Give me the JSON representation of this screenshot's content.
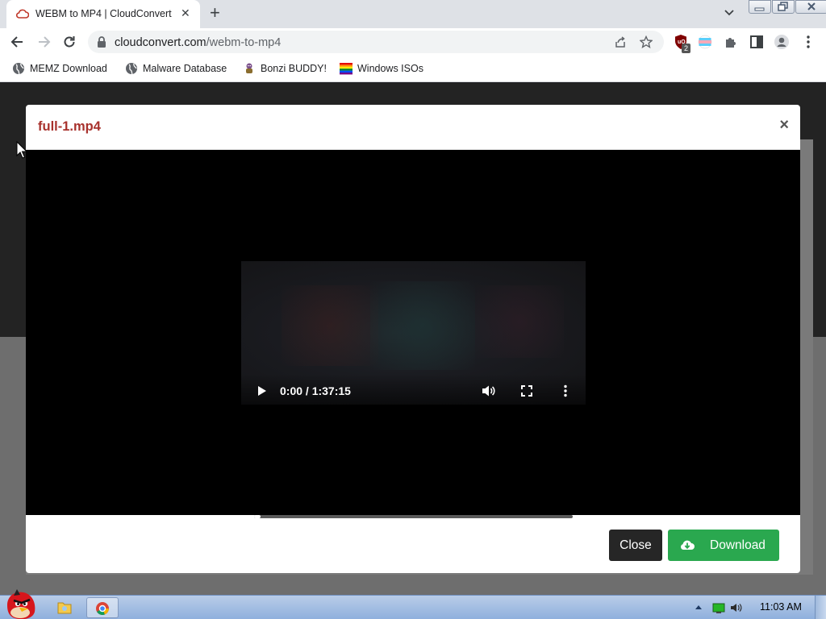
{
  "browser": {
    "tab": {
      "title": "WEBM to MP4 | CloudConvert",
      "favicon": "cloud-icon"
    },
    "omnibox": {
      "url_host": "cloudconvert.com",
      "url_path": "/webm-to-mp4"
    },
    "extension_badge": "2",
    "bookmarks": [
      {
        "label": "MEMZ Download",
        "icon": "globe-icon"
      },
      {
        "label": "Malware Database",
        "icon": "globe-icon"
      },
      {
        "label": "Bonzi BUDDY!",
        "icon": "bonzi-icon"
      },
      {
        "label": "Windows ISOs",
        "icon": "rainbow-flag-icon"
      }
    ]
  },
  "modal": {
    "title": "full-1.mp4",
    "close_glyph": "×",
    "video": {
      "time": "0:00 / 1:37:15",
      "progress": 0.02
    },
    "footer": {
      "close_label": "Close",
      "download_label": "Download"
    }
  },
  "taskbar": {
    "clock": "11:03 AM"
  },
  "colors": {
    "title_red": "#a8322d",
    "download_green": "#2aa84f",
    "close_dark": "#262626"
  }
}
